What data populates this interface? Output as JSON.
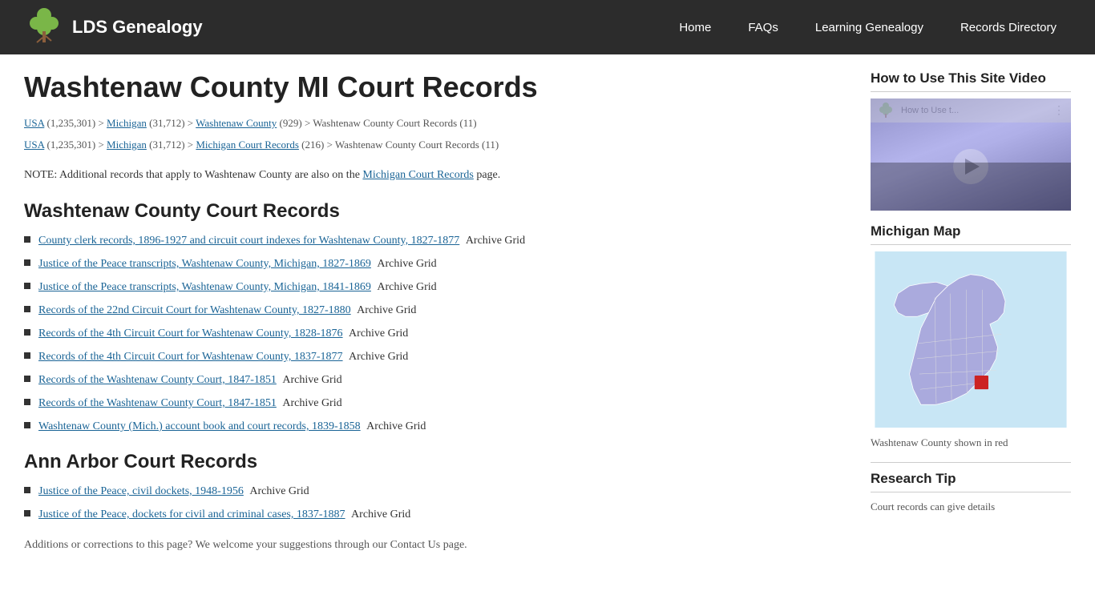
{
  "header": {
    "logo_text": "LDS Genealogy",
    "nav_items": [
      {
        "label": "Home",
        "href": "#"
      },
      {
        "label": "FAQs",
        "href": "#"
      },
      {
        "label": "Learning Genealogy",
        "href": "#"
      },
      {
        "label": "Records Directory",
        "href": "#"
      }
    ]
  },
  "main": {
    "page_title": "Washtenaw County MI Court Records",
    "breadcrumbs": [
      {
        "line": "USA (1,235,301) > Michigan (31,712) > Washtenaw County (929) > Washtenaw County Court Records (11)"
      },
      {
        "line": "USA (1,235,301) > Michigan (31,712) > Michigan Court Records (216) > Washtenaw County Court Records (11)"
      }
    ],
    "note": "NOTE: Additional records that apply to Washtenaw County are also on the Michigan Court Records page.",
    "note_link_text": "Michigan Court Records",
    "sections": [
      {
        "title": "Washtenaw County Court Records",
        "records": [
          {
            "link": "County clerk records, 1896-1927 and circuit court indexes for Washtenaw County, 1827-1877",
            "suffix": "Archive Grid"
          },
          {
            "link": "Justice of the Peace transcripts, Washtenaw County, Michigan, 1827-1869",
            "suffix": "Archive Grid"
          },
          {
            "link": "Justice of the Peace transcripts, Washtenaw County, Michigan, 1841-1869",
            "suffix": "Archive Grid"
          },
          {
            "link": "Records of the 22nd Circuit Court for Washtenaw County, 1827-1880",
            "suffix": "Archive Grid"
          },
          {
            "link": "Records of the 4th Circuit Court for Washtenaw County, 1828-1876",
            "suffix": "Archive Grid"
          },
          {
            "link": "Records of the 4th Circuit Court for Washtenaw County, 1837-1877",
            "suffix": "Archive Grid"
          },
          {
            "link": "Records of the Washtenaw County Court, 1847-1851",
            "suffix": "Archive Grid"
          },
          {
            "link": "Records of the Washtenaw County Court, 1847-1851",
            "suffix": "Archive Grid"
          },
          {
            "link": "Washtenaw County (Mich.) account book and court records, 1839-1858",
            "suffix": "Archive Grid"
          }
        ]
      },
      {
        "title": "Ann Arbor Court Records",
        "records": [
          {
            "link": "Justice of the Peace, civil dockets, 1948-1956",
            "suffix": "Archive Grid"
          },
          {
            "link": "Justice of the Peace, dockets for civil and criminal cases, 1837-1887",
            "suffix": "Archive Grid"
          }
        ]
      }
    ],
    "bottom_note": "Additions or corrections to this page? We welcome your suggestions through our Contact Us page."
  },
  "sidebar": {
    "video_section": {
      "title": "How to Use This Site Video",
      "video_title_bar": "How to Use t...",
      "play_label": "Play video"
    },
    "map_section": {
      "title": "Michigan Map",
      "caption": "Washtenaw County shown in red"
    },
    "research_tip_section": {
      "title": "Research Tip",
      "text": "Court records can give details"
    }
  }
}
